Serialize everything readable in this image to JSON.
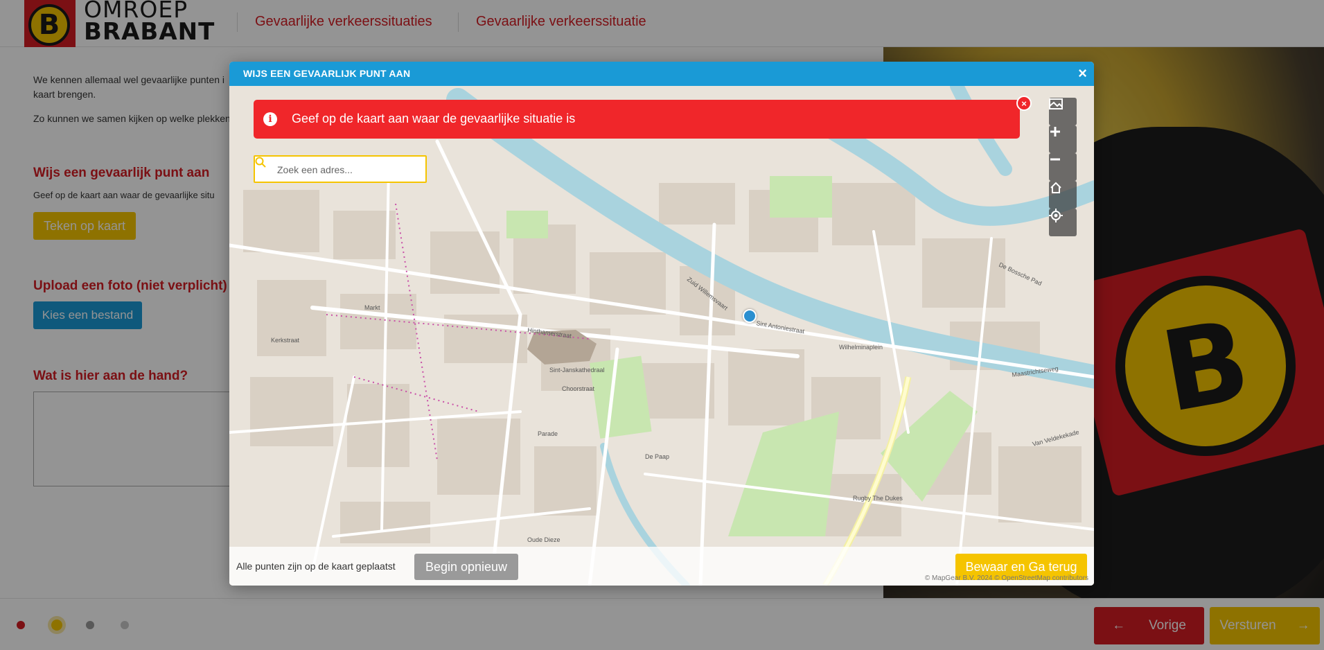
{
  "header": {
    "logo": {
      "line1": "OMROEP",
      "line2": "BRABANT",
      "badge_letter": "B"
    },
    "breadcrumbs": [
      "Gevaarlijke verkeerssituaties",
      "Gevaarlijke verkeerssituatie"
    ]
  },
  "form": {
    "intro": [
      "We kennen allemaal wel gevaarlijke punten i",
      "kaart brengen.",
      "Zo kunnen we samen kijken op welke plekken"
    ],
    "point_title": "Wijs een gevaarlijk punt aan",
    "point_text": "Geef op de kaart aan waar de gevaarlijke situ",
    "draw_button": "Teken op kaart",
    "upload_title": "Upload een foto (niet verplicht)",
    "upload_button": "Kies een bestand",
    "question_title": "Wat is hier aan de hand?"
  },
  "footer": {
    "dots": [
      {
        "color": "#d41d24"
      },
      {
        "color": "#f5c400"
      },
      {
        "color": "#9a9a9a"
      },
      {
        "color": "#c9c9c9"
      }
    ],
    "prev_label": "Vorige",
    "next_label": "Versturen"
  },
  "modal": {
    "title": "WIJS EEN GEVAARLIJK PUNT AAN",
    "close": "×",
    "alert": {
      "icon": "info-icon",
      "text": "Geef op de kaart aan waar de gevaarlijke situatie is",
      "close": "×"
    },
    "search": {
      "placeholder": "Zoek een adres..."
    },
    "controls": [
      "map-layers-icon",
      "zoom-in-icon",
      "zoom-out-icon",
      "home-icon",
      "locate-icon"
    ],
    "bottom": {
      "status": "Alle punten zijn op de kaart geplaatst",
      "reset": "Begin opnieuw",
      "save": "Bewaar en Ga terug"
    },
    "attribution": "© MapGear B.V. 2024 © OpenStreetMap contributors"
  },
  "map_labels": [
    {
      "text": "Markt"
    },
    {
      "text": "Hinthamerstraat"
    },
    {
      "text": "Sint-Janskathedraal"
    },
    {
      "text": "Parade"
    },
    {
      "text": "Zuid Willemsvaart"
    },
    {
      "text": "De Paap"
    },
    {
      "text": "Van Veldekekade"
    },
    {
      "text": "Rugby The Dukes"
    },
    {
      "text": "Maastrichtseweg"
    },
    {
      "text": "Wilhelminaplein"
    },
    {
      "text": "Sint Antoniestraat"
    },
    {
      "text": "De Bossche Pad"
    },
    {
      "text": "Choorstraat"
    },
    {
      "text": "Kerkstraat"
    },
    {
      "text": "Oude Dieze"
    }
  ],
  "colors": {
    "brand_red": "#d41d24",
    "brand_yellow": "#f5c400",
    "modal_blue": "#1a9ad6",
    "alert_red": "#f0262a",
    "canal": "#a9d3de",
    "park": "#c8e6b0"
  }
}
